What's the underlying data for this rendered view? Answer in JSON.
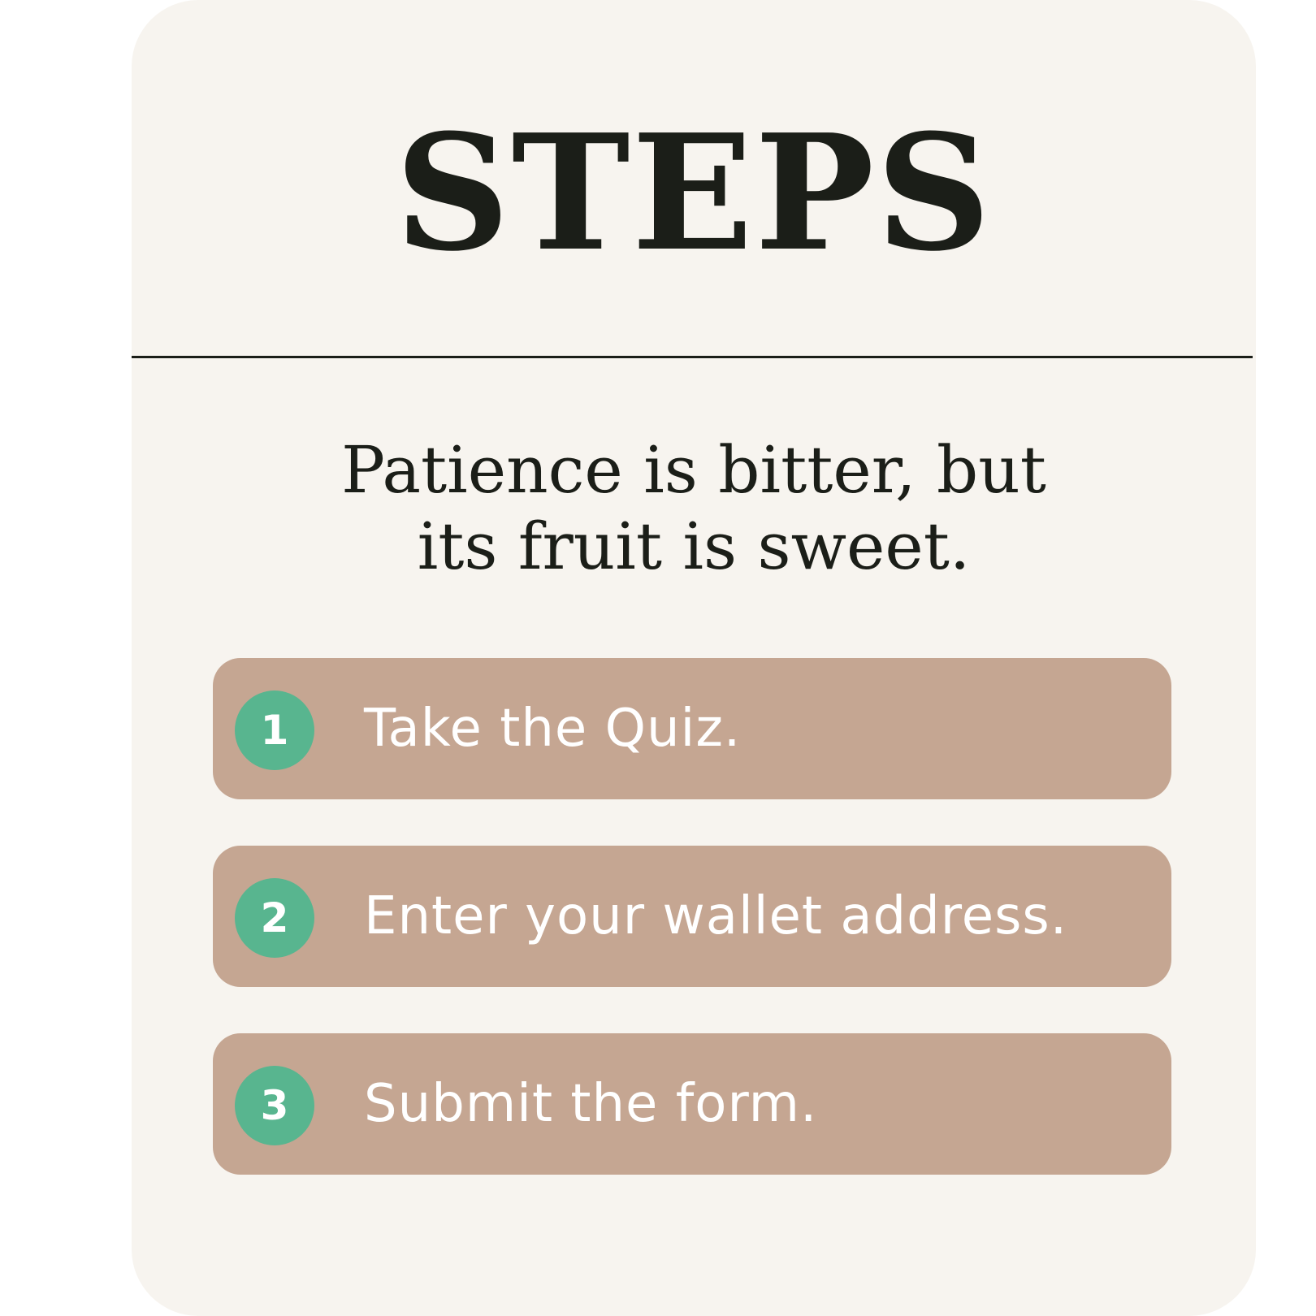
{
  "card": {
    "title": "STEPS",
    "quote_lines": [
      "Patience is bitter, but",
      "its fruit is sweet."
    ]
  },
  "steps": [
    {
      "number": "1",
      "label": "Take the Quiz."
    },
    {
      "number": "2",
      "label": "Enter your wallet address."
    },
    {
      "number": "3",
      "label": "Submit the form."
    }
  ],
  "colors": {
    "card_background": "#f7f4ef",
    "text_dark": "#1b1e18",
    "step_background": "#c5a692",
    "badge_green": "#58b58f",
    "step_text": "#ffffff"
  }
}
